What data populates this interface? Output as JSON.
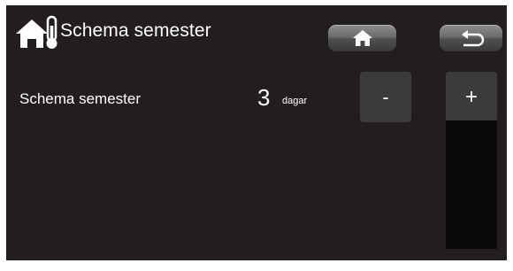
{
  "header": {
    "title": "Schema semester",
    "app_icon": "house-thermometer-icon",
    "home_button_icon": "home-icon",
    "back_button_icon": "back-arrow-icon"
  },
  "setting": {
    "label": "Schema semester",
    "value": "3",
    "unit": "dagar",
    "decrement_label": "-",
    "increment_label": "+"
  },
  "colors": {
    "background": "#221e1f",
    "text": "#ffffff",
    "stepper_button": "#3b3b3b",
    "header_button": "#6c6c6c"
  }
}
